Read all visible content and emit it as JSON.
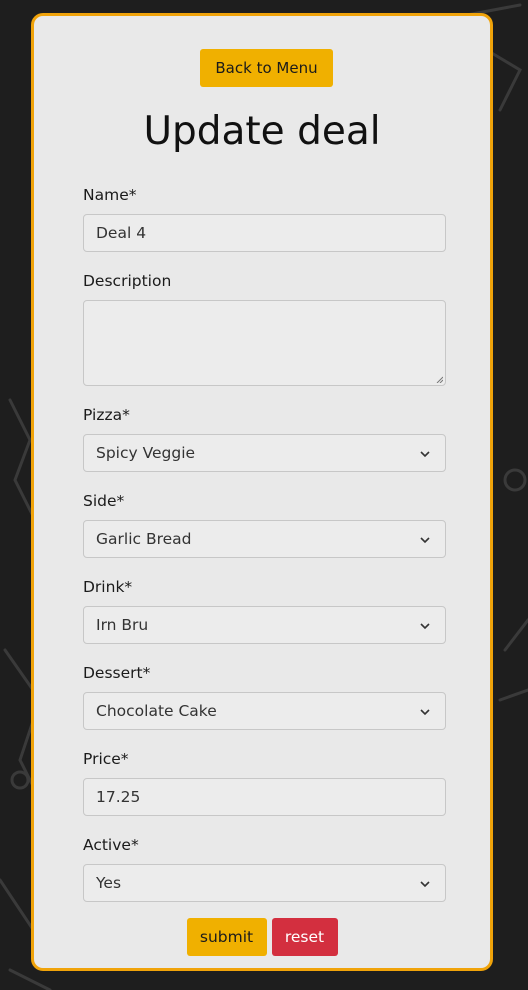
{
  "nav": {
    "back_label": "Back to Menu"
  },
  "page": {
    "title": "Update deal"
  },
  "form": {
    "name": {
      "label": "Name*",
      "value": "Deal 4"
    },
    "description": {
      "label": "Description",
      "value": ""
    },
    "pizza": {
      "label": "Pizza*",
      "value": "Spicy Veggie"
    },
    "side": {
      "label": "Side*",
      "value": "Garlic Bread"
    },
    "drink": {
      "label": "Drink*",
      "value": "Irn Bru"
    },
    "dessert": {
      "label": "Dessert*",
      "value": "Chocolate Cake"
    },
    "price": {
      "label": "Price*",
      "value": "17.25"
    },
    "active": {
      "label": "Active*",
      "value": "Yes"
    }
  },
  "actions": {
    "submit_label": "submit",
    "reset_label": "reset"
  },
  "colors": {
    "accent": "#f0b000",
    "danger": "#d32f3f",
    "border": "#f0a30a",
    "background": "#1e1e1e"
  },
  "icons": {
    "select_arrow": "chevron-down-icon",
    "textarea_resize": "resize-grip-icon"
  }
}
